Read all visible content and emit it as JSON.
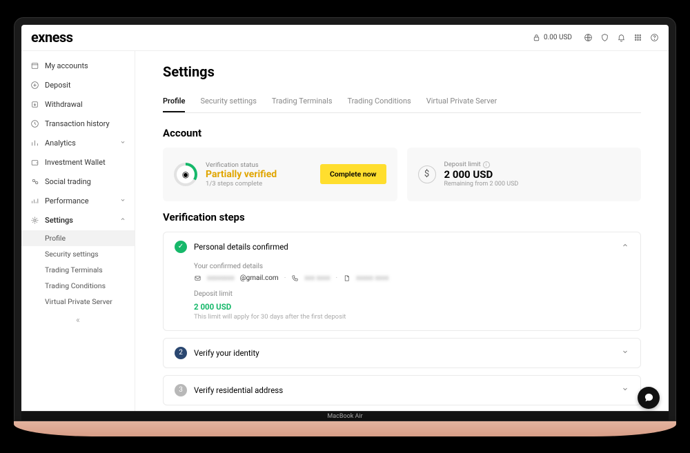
{
  "brand": "exness",
  "topbar": {
    "balance": "0.00 USD"
  },
  "sidebar": {
    "items": [
      {
        "label": "My accounts"
      },
      {
        "label": "Deposit"
      },
      {
        "label": "Withdrawal"
      },
      {
        "label": "Transaction history"
      },
      {
        "label": "Analytics"
      },
      {
        "label": "Investment Wallet"
      },
      {
        "label": "Social trading"
      },
      {
        "label": "Performance"
      },
      {
        "label": "Settings"
      }
    ],
    "settings_sub": [
      {
        "label": "Profile"
      },
      {
        "label": "Security settings"
      },
      {
        "label": "Trading Terminals"
      },
      {
        "label": "Trading Conditions"
      },
      {
        "label": "Virtual Private Server"
      }
    ]
  },
  "page": {
    "title": "Settings",
    "tabs": [
      "Profile",
      "Security settings",
      "Trading Terminals",
      "Trading Conditions",
      "Virtual Private Server"
    ],
    "account_heading": "Account",
    "verification": {
      "label": "Verification status",
      "title": "Partially verified",
      "progress": "1/3 steps complete",
      "button": "Complete now"
    },
    "deposit_limit": {
      "label": "Deposit limit",
      "amount": "2 000 USD",
      "remaining": "Remaining from 2 000 USD"
    },
    "steps_heading": "Verification steps",
    "step1": {
      "title": "Personal details confirmed",
      "details_label": "Your confirmed details",
      "email_masked": "@gmail.com",
      "deposit_limit_label": "Deposit limit",
      "deposit_limit_amount": "2 000 USD",
      "deposit_limit_note": "This limit will apply for 30 days after the first deposit"
    },
    "step2": {
      "num": "2",
      "title": "Verify your identity"
    },
    "step3": {
      "num": "3",
      "title": "Verify residential address"
    }
  },
  "device_label": "MacBook Air"
}
